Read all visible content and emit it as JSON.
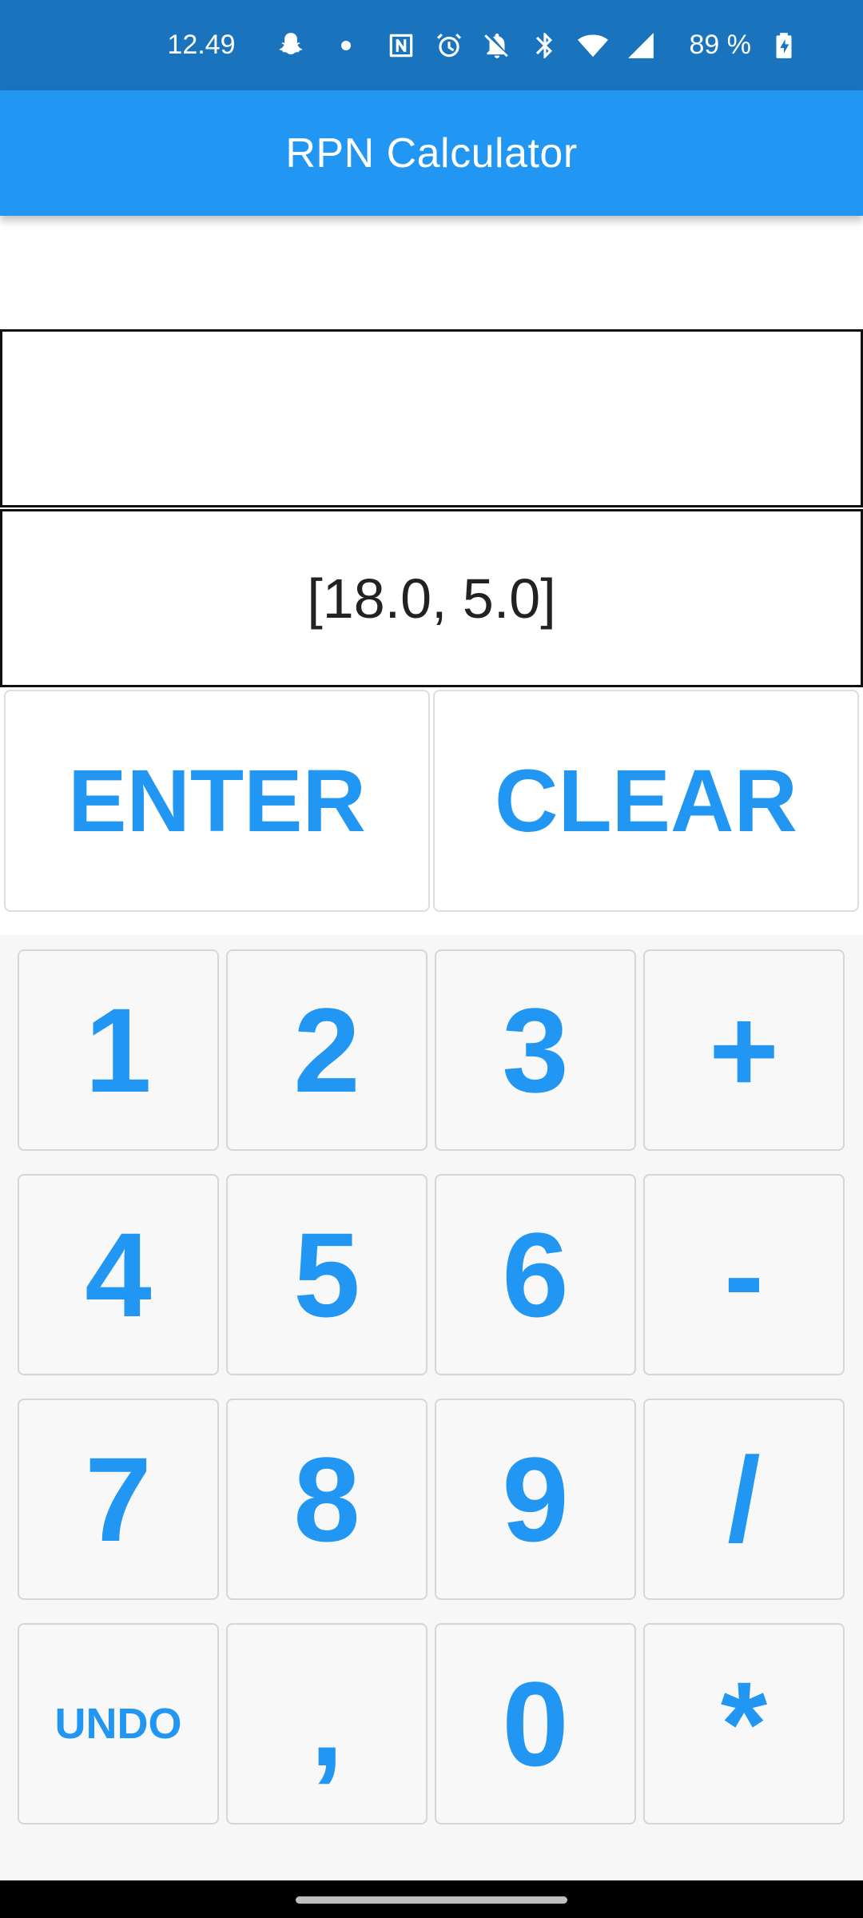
{
  "status_bar": {
    "time": "12.49",
    "battery_percent": "89 %",
    "icons": [
      "snapchat-icon",
      "dot",
      "nfc-icon",
      "alarm-icon",
      "bell-off-icon",
      "bluetooth-icon",
      "wifi-icon",
      "signal-icon",
      "battery-charging-icon"
    ]
  },
  "app_bar": {
    "title": "RPN Calculator",
    "color": "#2196f3"
  },
  "display": {
    "input_value": "",
    "stack_value": "[18.0, 5.0]"
  },
  "actions": {
    "enter_label": "ENTER",
    "clear_label": "CLEAR"
  },
  "keypad": {
    "rows": [
      [
        "1",
        "2",
        "3",
        "+"
      ],
      [
        "4",
        "5",
        "6",
        "-"
      ],
      [
        "7",
        "8",
        "9",
        "/"
      ],
      [
        "UNDO",
        ",",
        "0",
        "*"
      ]
    ],
    "accent_color": "#2196f3"
  }
}
